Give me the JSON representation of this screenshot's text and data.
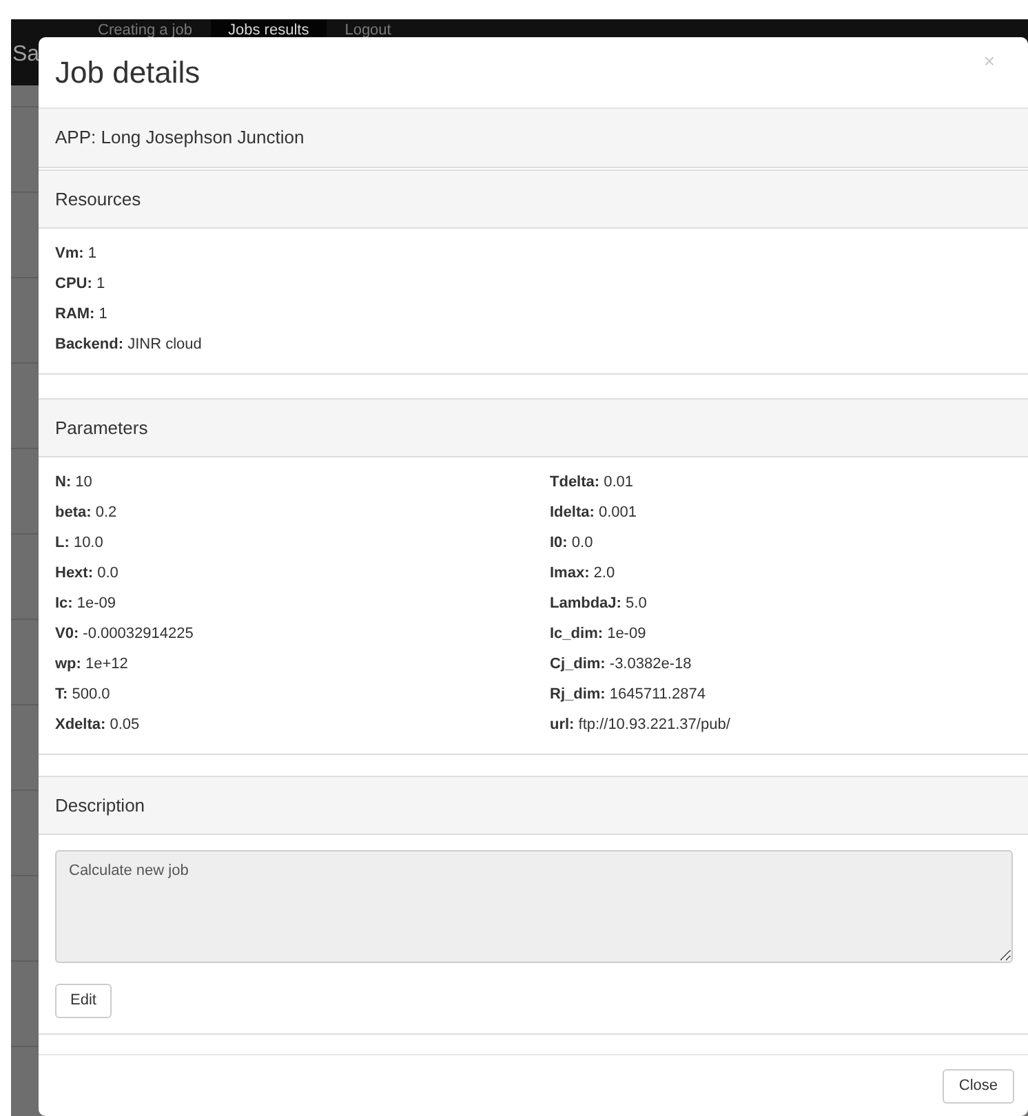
{
  "navbar": {
    "brand": "Sa",
    "tabs": [
      {
        "label": "Creating a job",
        "selected": false
      },
      {
        "label": "Jobs results",
        "selected": true
      },
      {
        "label": "Logout",
        "selected": false
      }
    ]
  },
  "modal": {
    "title": "Job details",
    "close_icon": "×",
    "app": "APP: Long Josephson Junction",
    "resources": {
      "heading": "Resources",
      "items": [
        {
          "label": "Vm:",
          "value": "1"
        },
        {
          "label": "CPU:",
          "value": "1"
        },
        {
          "label": "RAM:",
          "value": "1"
        },
        {
          "label": "Backend:",
          "value": "JINR cloud"
        }
      ]
    },
    "parameters": {
      "heading": "Parameters",
      "columns": [
        [
          {
            "label": "N:",
            "value": "10"
          },
          {
            "label": "beta:",
            "value": "0.2"
          },
          {
            "label": "L:",
            "value": "10.0"
          },
          {
            "label": "Hext:",
            "value": "0.0"
          },
          {
            "label": "Ic:",
            "value": "1e-09"
          },
          {
            "label": "V0:",
            "value": "-0.00032914225"
          },
          {
            "label": "wp:",
            "value": "1e+12"
          },
          {
            "label": "T:",
            "value": "500.0"
          },
          {
            "label": "Xdelta:",
            "value": "0.05"
          }
        ],
        [
          {
            "label": "Tdelta:",
            "value": "0.01"
          },
          {
            "label": "Idelta:",
            "value": "0.001"
          },
          {
            "label": "I0:",
            "value": "0.0"
          },
          {
            "label": "Imax:",
            "value": "2.0"
          },
          {
            "label": "LambdaJ:",
            "value": "5.0"
          },
          {
            "label": "Ic_dim:",
            "value": "1e-09"
          },
          {
            "label": "Cj_dim:",
            "value": "-3.0382e-18"
          },
          {
            "label": "Rj_dim:",
            "value": "1645711.2874"
          },
          {
            "label": "url:",
            "value": "ftp://10.93.221.37/pub/"
          }
        ]
      ]
    },
    "description": {
      "heading": "Description",
      "value": "Calculate new job",
      "disabled": true,
      "edit_button": "Edit"
    },
    "close_button": "Close"
  }
}
